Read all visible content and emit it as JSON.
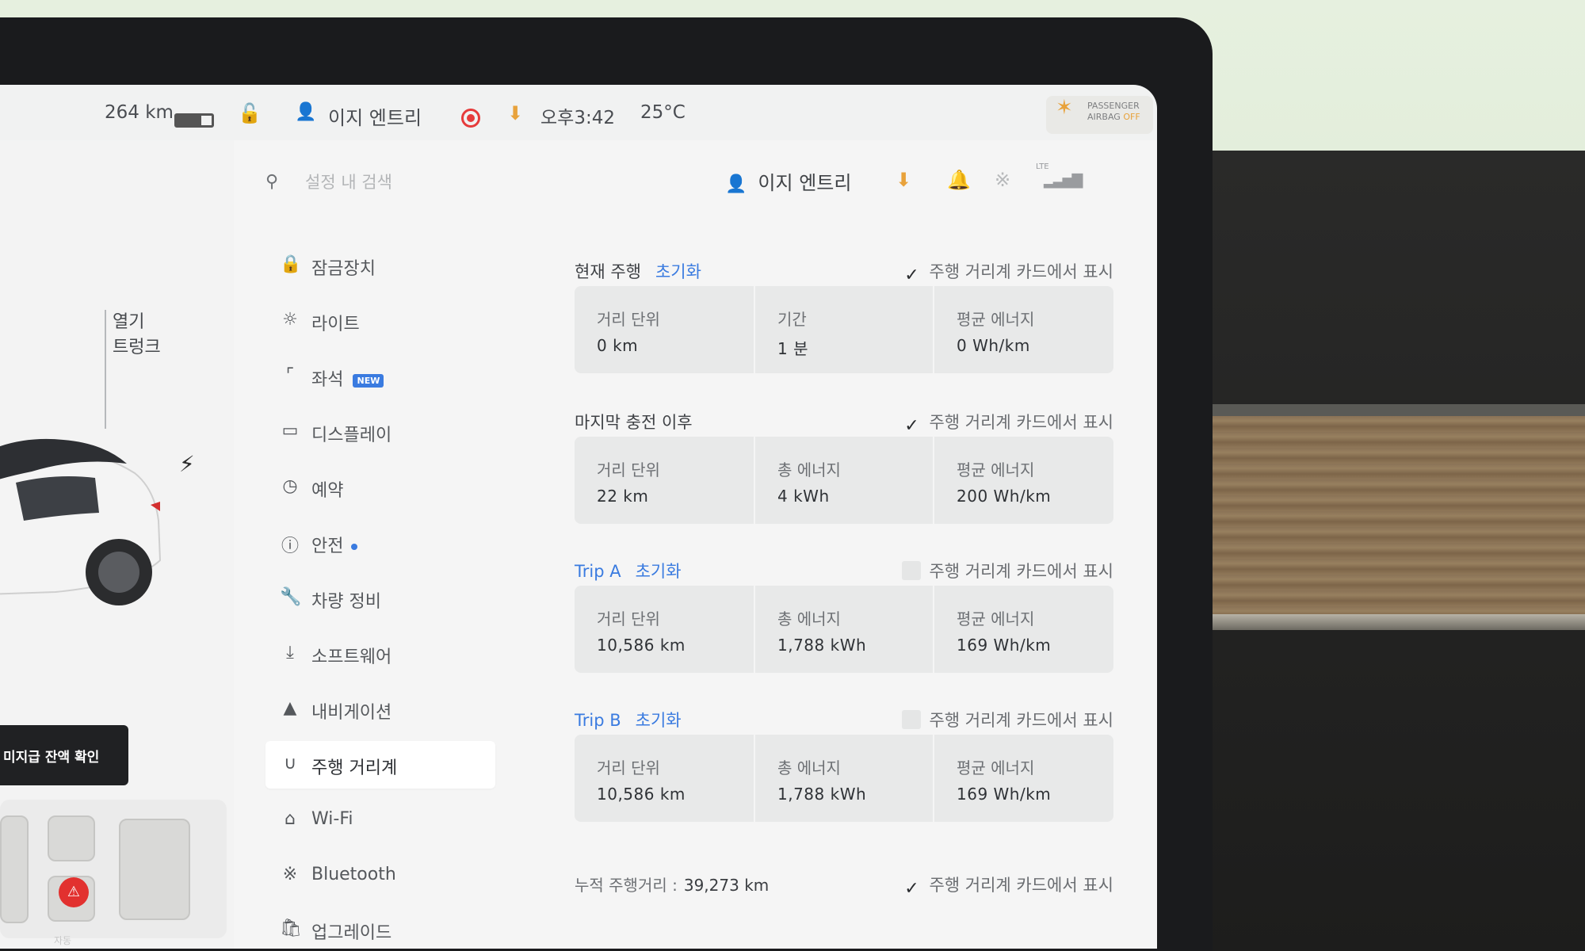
{
  "status_bar": {
    "range": "264 km",
    "profile": "이지 엔트리",
    "time": "오후3:42",
    "temperature": "25°C",
    "airbag_line1": "PASSENGER",
    "airbag_line2": "AIRBAG",
    "airbag_state": "OFF"
  },
  "car_panel": {
    "trunk_open_label": "열기",
    "trunk_label": "트렁크",
    "subsidy_button": "미지급 잔액 확인",
    "auto_label": "자동"
  },
  "settings": {
    "search_placeholder": "설정 내 검색",
    "profile_name": "이지 엔트리",
    "lte_label": "LTE",
    "nav": [
      {
        "label": "잠금장치",
        "icon": "lock-icon"
      },
      {
        "label": "라이트",
        "icon": "light-icon"
      },
      {
        "label": "좌석",
        "icon": "seat-icon",
        "badge": "NEW"
      },
      {
        "label": "디스플레이",
        "icon": "display-icon"
      },
      {
        "label": "예약",
        "icon": "schedule-icon"
      },
      {
        "label": "안전",
        "icon": "safety-icon"
      },
      {
        "label": "차량 정비",
        "icon": "wrench-icon"
      },
      {
        "label": "소프트웨어",
        "icon": "download-icon"
      },
      {
        "label": "내비게이션",
        "icon": "navigation-icon"
      },
      {
        "label": "주행 거리계",
        "icon": "odometer-icon",
        "active": true
      },
      {
        "label": "Wi-Fi",
        "icon": "wifi-icon"
      },
      {
        "label": "Bluetooth",
        "icon": "bluetooth-icon"
      },
      {
        "label": "업그레이드",
        "icon": "upgrade-icon"
      }
    ]
  },
  "trips": {
    "show_on_card_label": "주행 거리계 카드에서 표시",
    "reset_label": "초기화",
    "current": {
      "title": "현재 주행",
      "show_checked": true,
      "stats": [
        {
          "label": "거리 단위",
          "value": "0 km"
        },
        {
          "label": "기간",
          "value": "1 분"
        },
        {
          "label": "평균 에너지",
          "value": "0 Wh/km"
        }
      ]
    },
    "since_charge": {
      "title": "마지막 충전 이후",
      "show_checked": true,
      "stats": [
        {
          "label": "거리 단위",
          "value": "22 km"
        },
        {
          "label": "총 에너지",
          "value": "4 kWh"
        },
        {
          "label": "평균 에너지",
          "value": "200 Wh/km"
        }
      ]
    },
    "trip_a": {
      "title": "Trip A",
      "show_checked": false,
      "stats": [
        {
          "label": "거리 단위",
          "value": "10,586 km"
        },
        {
          "label": "총 에너지",
          "value": "1,788 kWh"
        },
        {
          "label": "평균 에너지",
          "value": "169 Wh/km"
        }
      ]
    },
    "trip_b": {
      "title": "Trip B",
      "show_checked": false,
      "stats": [
        {
          "label": "거리 단위",
          "value": "10,586 km"
        },
        {
          "label": "총 에너지",
          "value": "1,788 kWh"
        },
        {
          "label": "평균 에너지",
          "value": "169 Wh/km"
        }
      ]
    },
    "odometer_label": "누적 주행거리 :",
    "odometer_value": "39,273 km",
    "odometer_show_checked": true
  },
  "colors": {
    "accent_blue": "#3a7be0",
    "warning_orange": "#e8a23b",
    "record_red": "#e63b3b"
  }
}
